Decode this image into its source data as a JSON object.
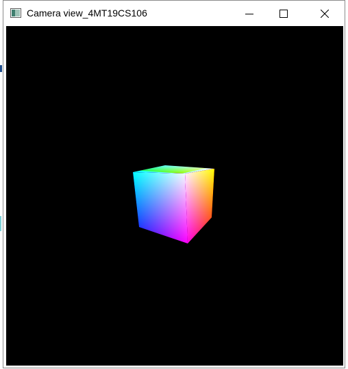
{
  "window": {
    "title": "Camera view_4MT19CS106",
    "buttons": {
      "minimize_icon": "minimize-icon",
      "maximize_icon": "maximize-icon",
      "close_icon": "close-icon"
    }
  },
  "viewport": {
    "background": "#000000",
    "object": "rgb-color-cube",
    "vertex_colors": {
      "front_top_left": "#00ffff",
      "front_top_right": "#ffffff",
      "front_bottom_left": "#0000ff",
      "front_bottom_right": "#ff00ff",
      "back_top_left": "#00ff00",
      "back_top_right": "#ffff00",
      "back_bottom_right": "#ff0000"
    }
  }
}
